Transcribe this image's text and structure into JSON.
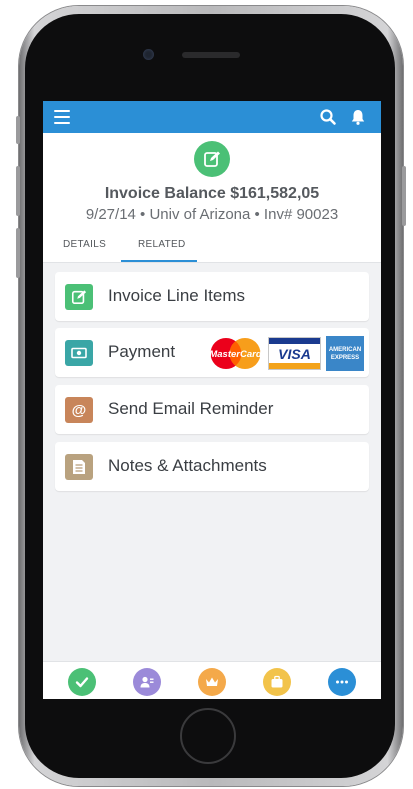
{
  "colors": {
    "topbar": "#2b8fd6",
    "record_icon": "#4bc076",
    "line_items_icon": "#4bc076",
    "payment_icon": "#3aa6a6",
    "email_icon": "#c8855a",
    "notes_icon": "#b9a27f",
    "nav_tasks": "#4bc076",
    "nav_contacts": "#9b8ad9",
    "nav_leads": "#f4a94a",
    "nav_opportunities": "#f2c34a",
    "nav_more": "#2b8fd6"
  },
  "header": {
    "title": "Invoice Balance $161,582,05",
    "subtitle": "9/27/14 • Univ of Arizona • Inv# 90023",
    "record_icon": "edit-icon"
  },
  "tabs": [
    {
      "label": "DETAILS",
      "active": false
    },
    {
      "label": "RELATED",
      "active": true
    }
  ],
  "related_items": [
    {
      "label": "Invoice Line Items",
      "icon": "edit-icon"
    },
    {
      "label": "Payment",
      "icon": "money-icon"
    },
    {
      "label": "Send Email Reminder",
      "icon": "at-icon"
    },
    {
      "label": "Notes & Attachments",
      "icon": "note-icon"
    }
  ],
  "payment_cards": {
    "mastercard": "MasterCard",
    "visa": "VISA",
    "amex_line1": "AMERICAN",
    "amex_line2": "EXPRESS"
  },
  "bottom_nav": [
    {
      "icon": "check-icon"
    },
    {
      "icon": "contact-icon"
    },
    {
      "icon": "crown-icon"
    },
    {
      "icon": "briefcase-icon"
    },
    {
      "icon": "more-icon"
    }
  ]
}
